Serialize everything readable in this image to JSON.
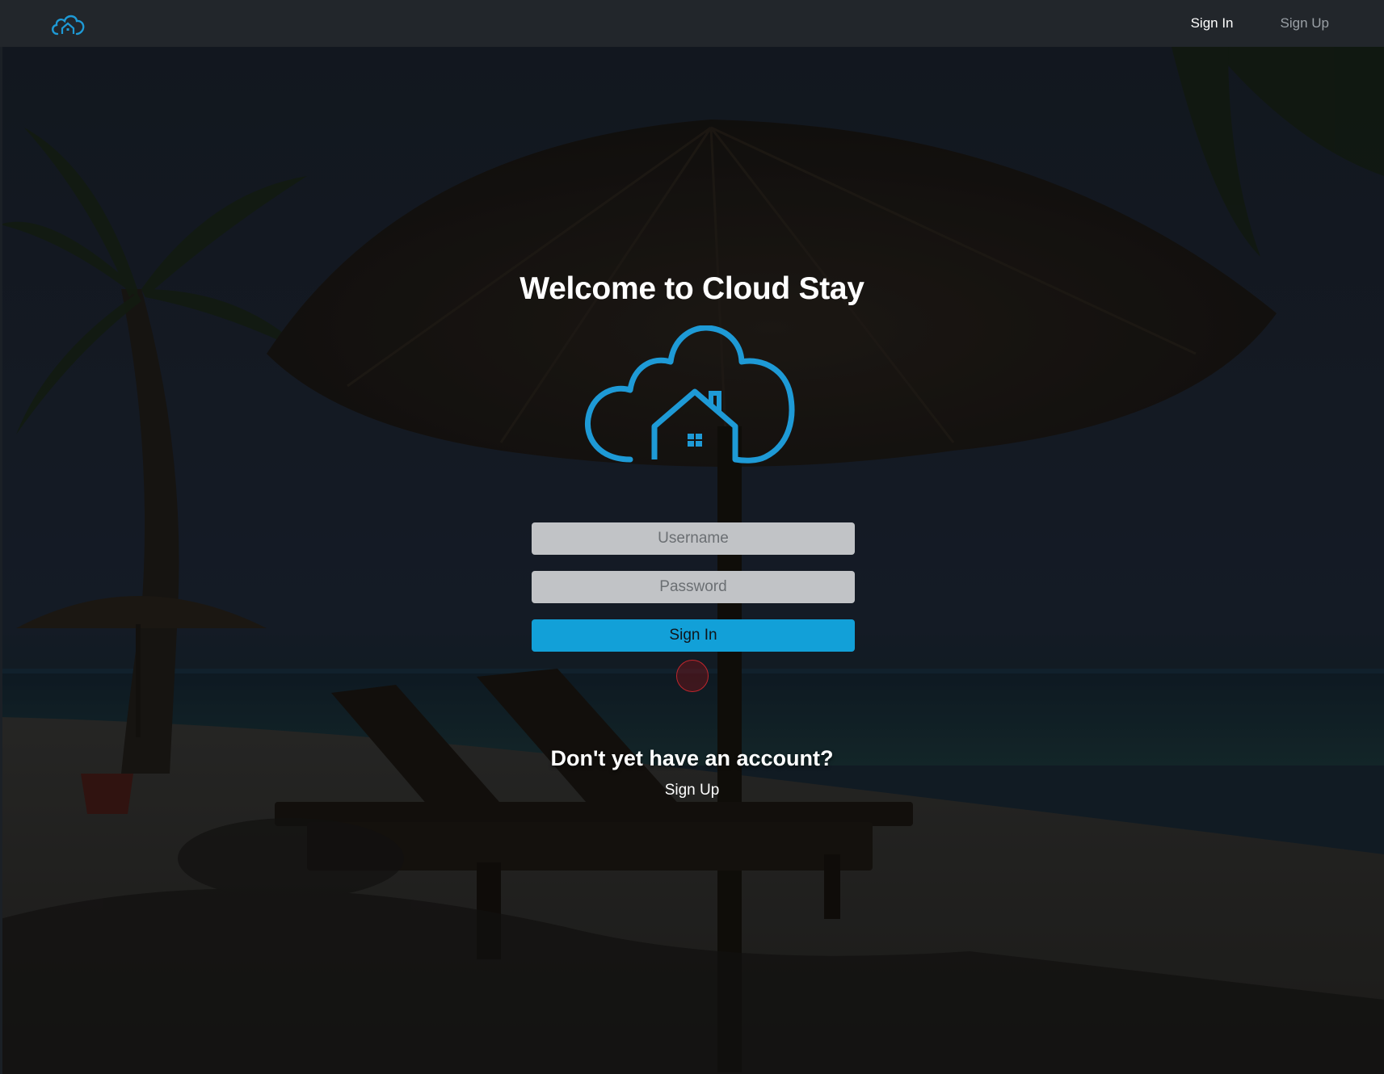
{
  "navbar": {
    "brand_icon": "cloud-home-icon",
    "links": [
      {
        "label": "Sign In",
        "state": "active"
      },
      {
        "label": "Sign Up",
        "state": "inactive"
      }
    ]
  },
  "main": {
    "title": "Welcome to Cloud Stay",
    "logo_icon": "cloud-home-icon",
    "form": {
      "username_placeholder": "Username",
      "username_value": "",
      "password_placeholder": "Password",
      "password_value": "",
      "submit_label": "Sign In"
    },
    "signup_prompt": "Don't yet have an account?",
    "signup_link": "Sign Up"
  },
  "colors": {
    "navbar_bg": "#22262b",
    "accent": "#12a0d8",
    "logo_blue": "#1e9ad6",
    "input_bg": "#c1c3c6",
    "cursor_marker": "#c0262d"
  }
}
